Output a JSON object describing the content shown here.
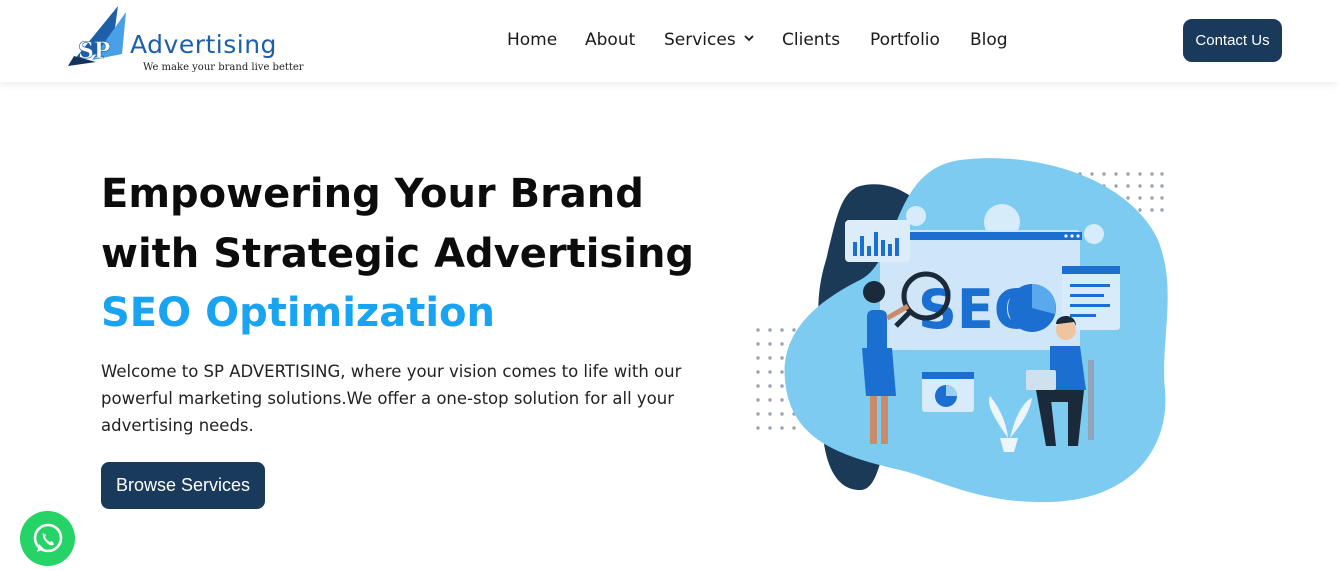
{
  "brand": {
    "name": "Advertising",
    "initials": "SP",
    "tagline": "We make your brand live better"
  },
  "nav": {
    "items": [
      {
        "label": "Home"
      },
      {
        "label": "About"
      },
      {
        "label": "Services",
        "has_dropdown": true
      },
      {
        "label": "Clients"
      },
      {
        "label": "Portfolio"
      },
      {
        "label": "Blog"
      }
    ],
    "contact_label": "Contact Us"
  },
  "hero": {
    "title_line1": "Empowering Your Brand",
    "title_line2": "with Strategic Advertising",
    "rotating_text": "SEO Optimization",
    "description": "Welcome to SP ADVERTISING, where your vision comes to life with our powerful marketing solutions.We offer a one-stop solution for all your advertising needs.",
    "cta_label": "Browse Services"
  },
  "illustration": {
    "seo_text": "SEO"
  },
  "colors": {
    "primary_dark": "#1a3a5c",
    "accent_blue": "#1aa3f0",
    "blob_light": "#7ecbf2",
    "whatsapp_green": "#25d366"
  },
  "icons": {
    "whatsapp": "whatsapp-icon",
    "dropdown": "chevron-down-icon"
  }
}
